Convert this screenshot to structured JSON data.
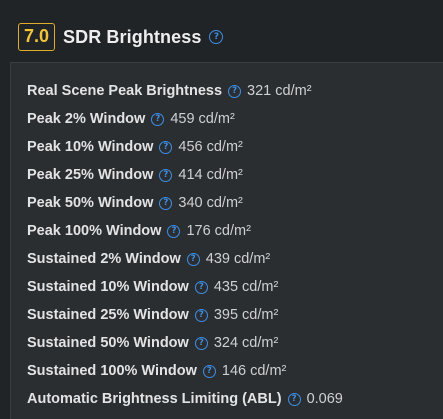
{
  "section": {
    "score": "7.0",
    "title": "SDR Brightness",
    "help_icon": "question-circle-icon"
  },
  "rows": [
    {
      "label": "Real Scene Peak Brightness",
      "value": "321 cd/m²"
    },
    {
      "label": "Peak 2% Window",
      "value": "459 cd/m²"
    },
    {
      "label": "Peak 10% Window",
      "value": "456 cd/m²"
    },
    {
      "label": "Peak 25% Window",
      "value": "414 cd/m²"
    },
    {
      "label": "Peak 50% Window",
      "value": "340 cd/m²"
    },
    {
      "label": "Peak 100% Window",
      "value": "176 cd/m²"
    },
    {
      "label": "Sustained 2% Window",
      "value": "439 cd/m²"
    },
    {
      "label": "Sustained 10% Window",
      "value": "435 cd/m²"
    },
    {
      "label": "Sustained 25% Window",
      "value": "395 cd/m²"
    },
    {
      "label": "Sustained 50% Window",
      "value": "324 cd/m²"
    },
    {
      "label": "Sustained 100% Window",
      "value": "146 cd/m²"
    },
    {
      "label": "Automatic Brightness Limiting (ABL)",
      "value": "0.069"
    }
  ],
  "colors": {
    "background": "#212426",
    "panel": "#2b2e31",
    "score_border": "#e0ad2a",
    "score_text": "#f2c23a",
    "help_icon": "#3d8fe6"
  }
}
